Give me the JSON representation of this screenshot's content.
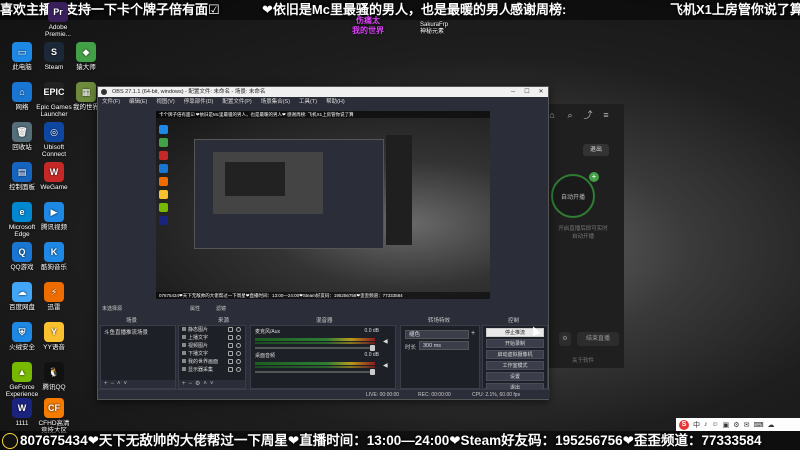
{
  "marquee_top": {
    "segments": [
      "喜欢主播的支持一下卡个牌子倍有面☑",
      "❤依旧是Mc里最骚的男人，也是最暖的男人❤",
      "感谢周榜:",
      "飞机X1上房管你说了算"
    ]
  },
  "marquee_bottom": {
    "text": "807675434❤天下无敌帅的大佬帮过一下周星❤直播时间：13:00—24:00❤Steam好友码：195256756❤歪歪频道：77333584"
  },
  "desktop_icons": [
    {
      "label": "Adobe Premie...",
      "color": "#3a1f5d",
      "glyph": "Pr"
    },
    {
      "label": "此电脑",
      "color": "#1e88e5",
      "glyph": "▭"
    },
    {
      "label": "Steam",
      "color": "#1b2838",
      "glyph": "S"
    },
    {
      "label": "猿大师",
      "color": "#43a047",
      "glyph": "◆"
    },
    {
      "label": "网络",
      "color": "#1976d2",
      "glyph": "⌂"
    },
    {
      "label": "Epic Games Launcher",
      "color": "#222222",
      "glyph": "EPIC"
    },
    {
      "label": "我的世界",
      "color": "#6d8b3a",
      "glyph": "▦"
    },
    {
      "label": "回收站",
      "color": "#546e7a",
      "glyph": "🗑"
    },
    {
      "label": "Ubisoft Connect",
      "color": "#0d47a1",
      "glyph": "◎"
    },
    {
      "label": "控制面板",
      "color": "#1565c0",
      "glyph": "▤"
    },
    {
      "label": "WeGame",
      "color": "#c62828",
      "glyph": "W"
    },
    {
      "label": "Microsoft Edge",
      "color": "#0288d1",
      "glyph": "e"
    },
    {
      "label": "腾讯视频",
      "color": "#1e88e5",
      "glyph": "▶"
    },
    {
      "label": "QQ游戏",
      "color": "#1976d2",
      "glyph": "Q"
    },
    {
      "label": "酷狗音乐",
      "color": "#1e88e5",
      "glyph": "K"
    },
    {
      "label": "百度网盘",
      "color": "#42a5f5",
      "glyph": "☁"
    },
    {
      "label": "迅雷",
      "color": "#ef6c00",
      "glyph": "⚡"
    },
    {
      "label": "火绒安全",
      "color": "#1e88e5",
      "glyph": "⛨"
    },
    {
      "label": "YY语音",
      "color": "#fbc02d",
      "glyph": "Y"
    },
    {
      "label": "GeForce Experience",
      "color": "#76b900",
      "glyph": "▲"
    },
    {
      "label": "腾讯QQ",
      "color": "#111111",
      "glyph": "🐧"
    },
    {
      "label": "1111",
      "color": "#1a237e",
      "glyph": "W"
    },
    {
      "label": "CFHD高清竞技大区",
      "color": "#f57c00",
      "glyph": "CF"
    }
  ],
  "watermark": {
    "logo_text": "伤痛太\n我的世界",
    "deco_text": "SakuraFrp\n神秘元素"
  },
  "obs": {
    "title": "OBS 27.1.1 (64-bit, windows) - 配置文件: 未命名 - 场景: 未命名",
    "menu": [
      "文件(F)",
      "编辑(E)",
      "视图(V)",
      "停靠部件(D)",
      "配置文件(P)",
      "场景集合(S)",
      "工具(T)",
      "帮助(H)"
    ],
    "preview_marquee_top": "卡个牌子倍有面☑  ❤依旧是Mc里最骚的男人，也是最暖的男人❤  感谢周榜:  飞机X1上房管你说了算",
    "preview_marquee_bottom": "07675434❤天下无敌帅的大佬帮过一下周星❤直播时间：13:00—24:00❤Steam好友码：195256756❤歪歪频道：77333584",
    "source_toolbar": {
      "properties": "属性",
      "filters": "滤镜"
    },
    "selected_label": "未选择源",
    "docks": {
      "scenes": "场景",
      "sources": "来源",
      "mixer": "混音器",
      "transitions": "转场特效",
      "controls": "控制"
    },
    "scenes": [
      "斗鱼直播推流场景"
    ],
    "sources": [
      "静态图片",
      "上播文字",
      "视频图片",
      "下播文字",
      "我的世界画面",
      "显示器采集"
    ],
    "mixer": [
      {
        "name": "麦克风/Aux",
        "db": "0.0 dB"
      },
      {
        "name": "桌面音频",
        "db": "0.0 dB"
      }
    ],
    "transition": {
      "type": "褪色",
      "duration_label": "时长",
      "duration_value": "300 ms"
    },
    "controls": [
      "停止推流",
      "开始录制",
      "启动虚拟摄像机",
      "工作室模式",
      "设置",
      "退出"
    ],
    "status": {
      "live": "LIVE: 00:00:00",
      "rec": "REC: 00:00:00",
      "cpu": "CPU: 2.1%, 60.00 fps"
    }
  },
  "side_app": {
    "exit_label": "退出",
    "ring_label": "自动开播",
    "hint_1": "开启直播后即可实时",
    "hint_2": "自动开播",
    "left_button": "⚙",
    "right_button": "结束直播",
    "footer": "关于软件"
  },
  "tray": {
    "logo": "S",
    "items": [
      "中",
      "♪",
      "☺",
      "▣",
      "⚙",
      "✉",
      "⌨",
      "☁"
    ]
  }
}
